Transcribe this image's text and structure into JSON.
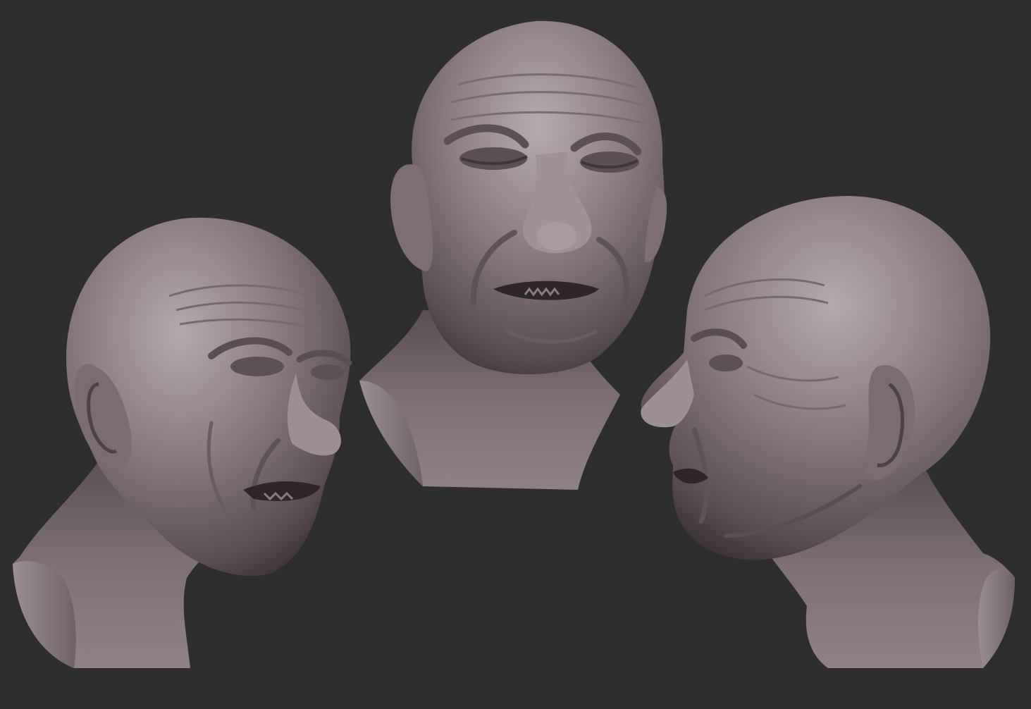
{
  "canvas": {
    "background": "#2e2e2e"
  },
  "material": {
    "base_color": "#86777c",
    "highlight_color": "#b5a9ad",
    "shadow_color": "#3f3639"
  },
  "busts": [
    {
      "view": "three-quarter-left"
    },
    {
      "view": "front"
    },
    {
      "view": "profile-left"
    }
  ]
}
